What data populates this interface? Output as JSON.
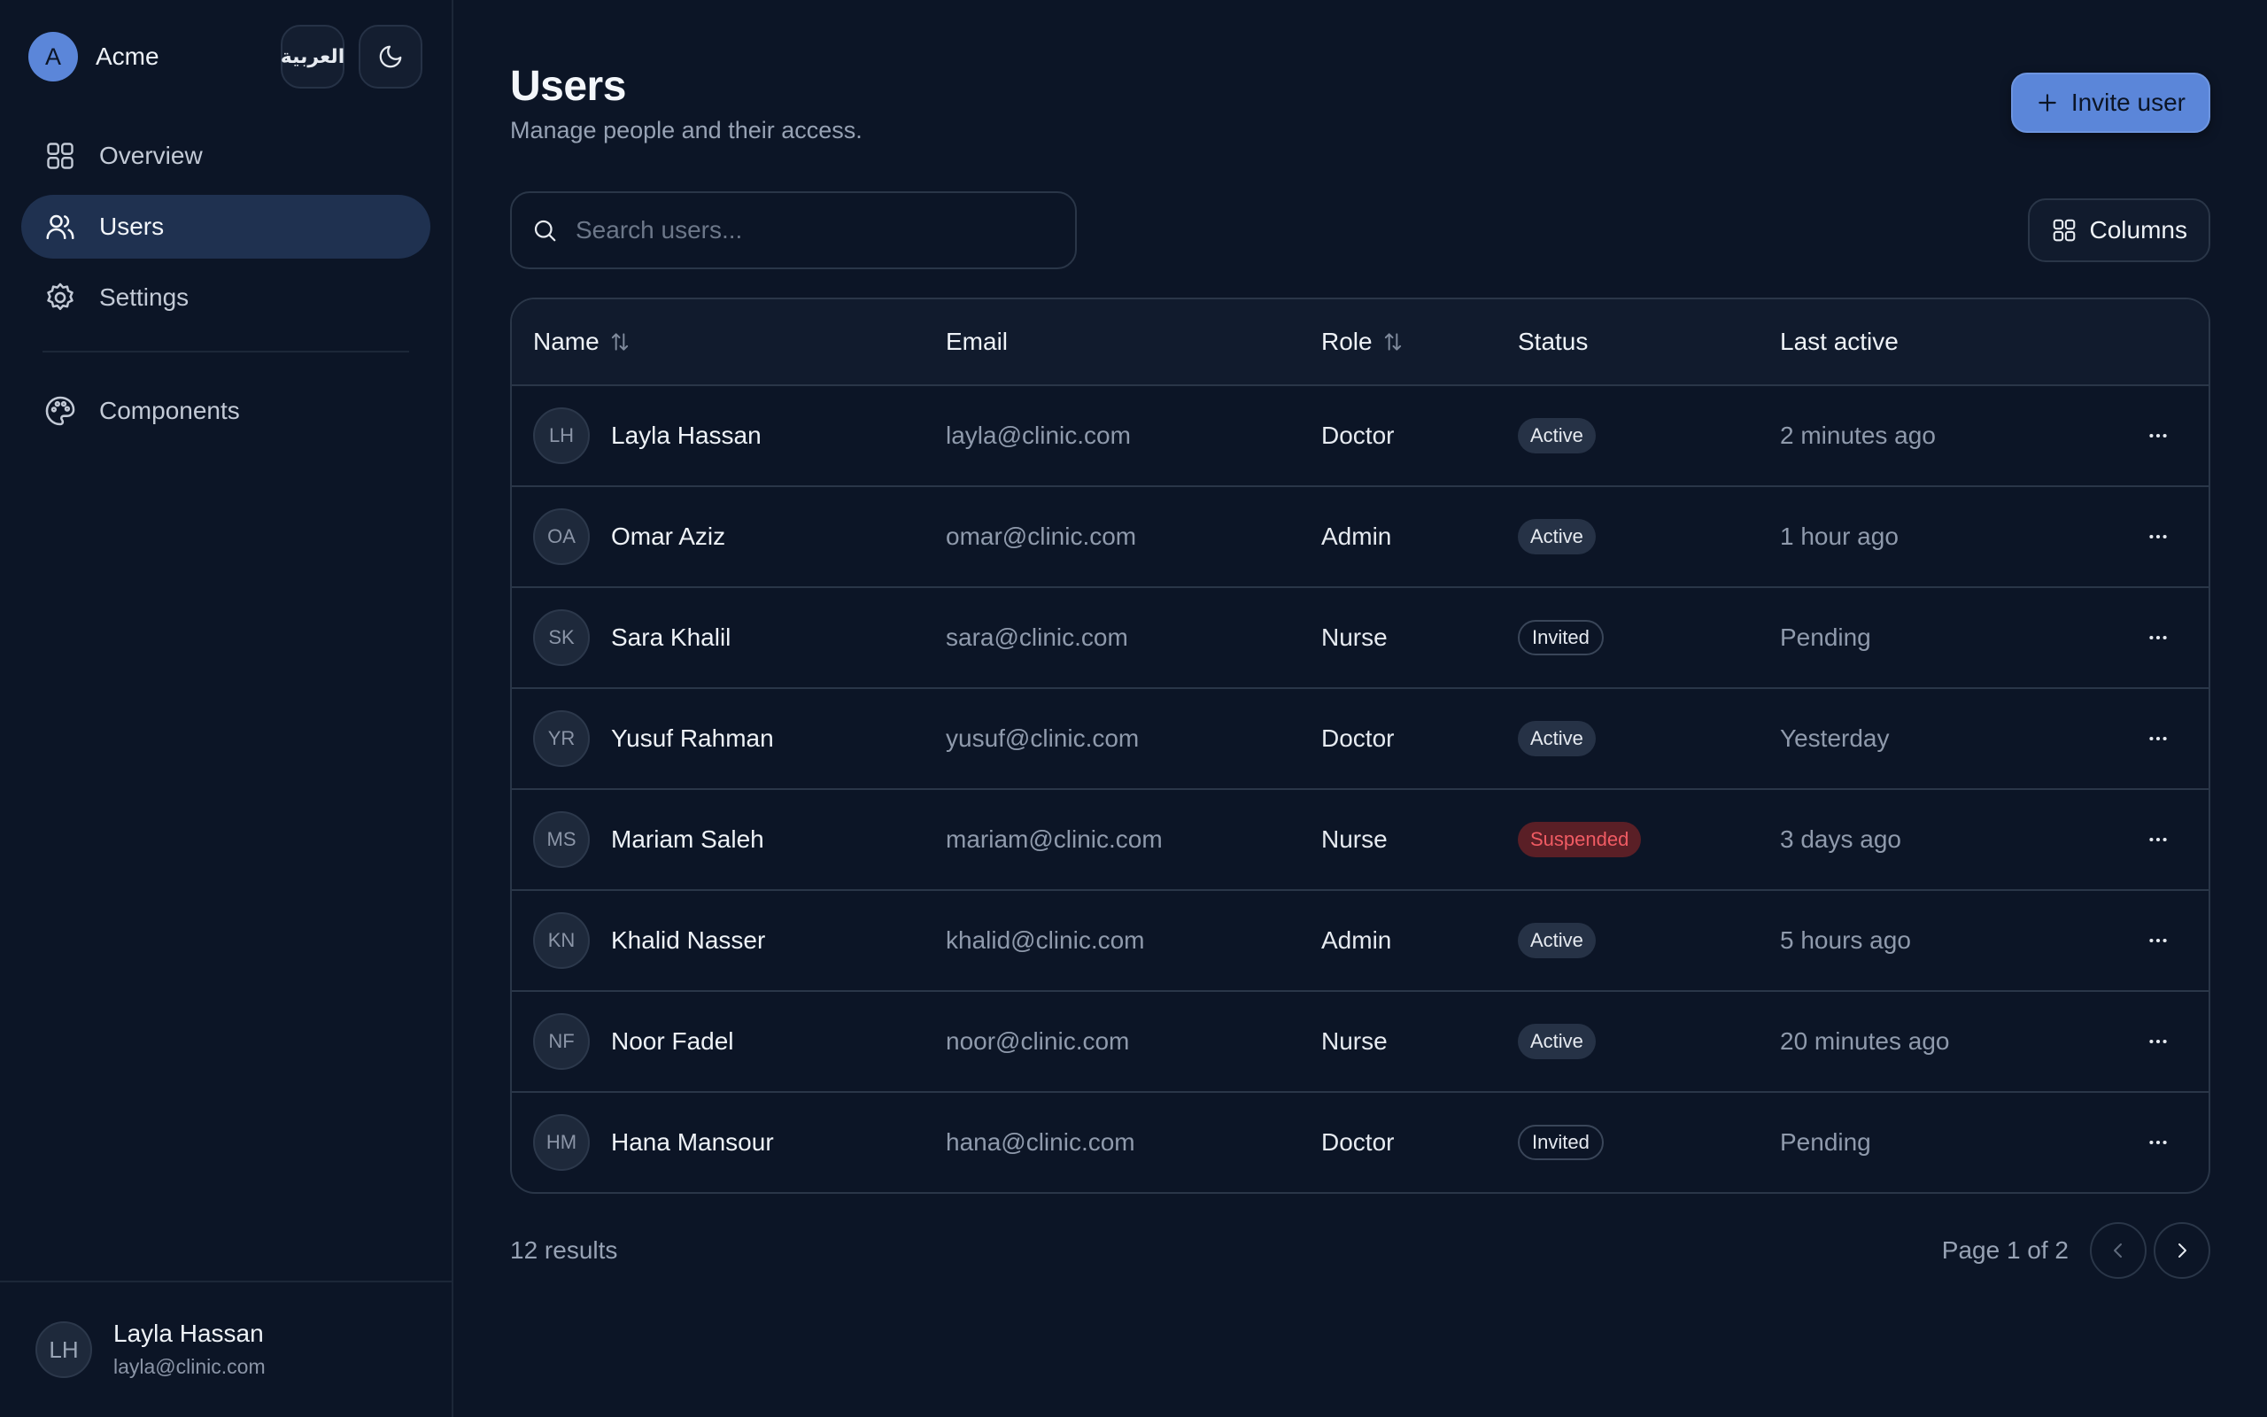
{
  "brand": {
    "logo_letter": "A",
    "name": "Acme"
  },
  "language_toggle": {
    "label": "العربية"
  },
  "theme_toggle": {
    "icon": "moon-icon"
  },
  "sidebar": {
    "items": [
      {
        "label": "Overview",
        "icon": "grid-icon",
        "active": false
      },
      {
        "label": "Users",
        "icon": "users-icon",
        "active": true
      },
      {
        "label": "Settings",
        "icon": "gear-icon",
        "active": false
      },
      {
        "label": "Components",
        "icon": "palette-icon",
        "active": false
      }
    ],
    "user": {
      "initials": "LH",
      "name": "Layla Hassan",
      "email": "layla@clinic.com"
    }
  },
  "header": {
    "title": "Users",
    "subtitle": "Manage people and their access.",
    "invite_label": "Invite user"
  },
  "search": {
    "placeholder": "Search users...",
    "value": ""
  },
  "columns_button": {
    "label": "Columns"
  },
  "table": {
    "headers": {
      "name": "Name",
      "email": "Email",
      "role": "Role",
      "status": "Status",
      "last_active": "Last active"
    },
    "rows": [
      {
        "initials": "LH",
        "name": "Layla Hassan",
        "email": "layla@clinic.com",
        "role": "Doctor",
        "status": "Active",
        "last_active": "2 minutes ago"
      },
      {
        "initials": "OA",
        "name": "Omar Aziz",
        "email": "omar@clinic.com",
        "role": "Admin",
        "status": "Active",
        "last_active": "1 hour ago"
      },
      {
        "initials": "SK",
        "name": "Sara Khalil",
        "email": "sara@clinic.com",
        "role": "Nurse",
        "status": "Invited",
        "last_active": "Pending"
      },
      {
        "initials": "YR",
        "name": "Yusuf Rahman",
        "email": "yusuf@clinic.com",
        "role": "Doctor",
        "status": "Active",
        "last_active": "Yesterday"
      },
      {
        "initials": "MS",
        "name": "Mariam Saleh",
        "email": "mariam@clinic.com",
        "role": "Nurse",
        "status": "Suspended",
        "last_active": "3 days ago"
      },
      {
        "initials": "KN",
        "name": "Khalid Nasser",
        "email": "khalid@clinic.com",
        "role": "Admin",
        "status": "Active",
        "last_active": "5 hours ago"
      },
      {
        "initials": "NF",
        "name": "Noor Fadel",
        "email": "noor@clinic.com",
        "role": "Nurse",
        "status": "Active",
        "last_active": "20 minutes ago"
      },
      {
        "initials": "HM",
        "name": "Hana Mansour",
        "email": "hana@clinic.com",
        "role": "Doctor",
        "status": "Invited",
        "last_active": "Pending"
      }
    ]
  },
  "footer": {
    "results": "12 results",
    "page_label": "Page 1 of 2"
  },
  "colors": {
    "accent": "#5b86d9",
    "background": "#0c1526",
    "active_nav": "#1f3150",
    "danger": "#f05b63"
  }
}
